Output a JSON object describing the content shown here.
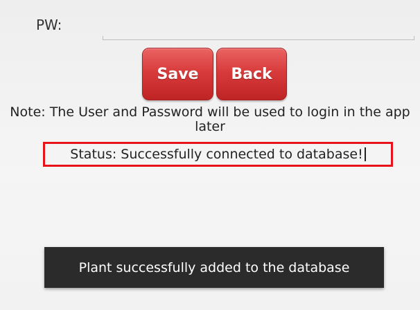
{
  "form": {
    "pw_label": "PW:",
    "pw_value": ""
  },
  "buttons": {
    "save_label": "Save",
    "back_label": "Back"
  },
  "note": {
    "text": "Note: The User and Password will be used to login in the app later"
  },
  "status": {
    "text": "Status: Successfully connected to database!"
  },
  "toast": {
    "text": "Plant successfully added to the database"
  },
  "colors": {
    "button_red": "#d83b3b",
    "highlight_border": "#e8131a",
    "toast_background": "#2b2b2b"
  }
}
